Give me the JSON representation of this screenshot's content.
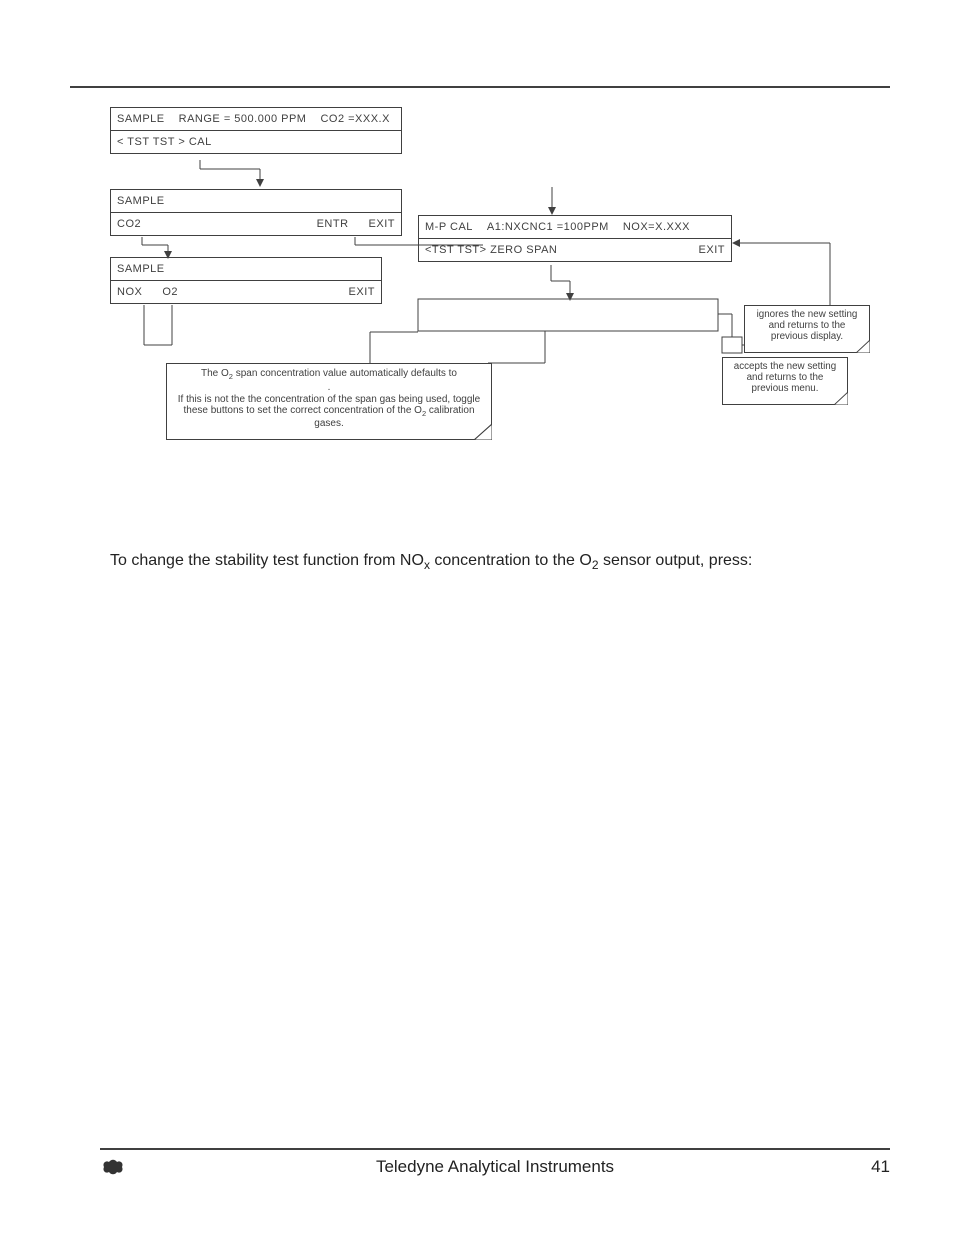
{
  "panel1": {
    "sample": "SAMPLE",
    "range": "RANGE = 500.000 PPM",
    "co2v": "CO2 =XXX.X",
    "row2": "< TST  TST >     CAL"
  },
  "panel2": {
    "sample": "SAMPLE",
    "co2": "CO2",
    "entr": "ENTR",
    "exit": "EXIT"
  },
  "panel3": {
    "sample": "SAMPLE",
    "nox": "NOX",
    "o2": "O2",
    "exit": "EXIT"
  },
  "panel4": {
    "mpcal": "M-P CAL",
    "a1": "A1:NXCNC1  =100PPM",
    "nox": "NOX=X.XXX",
    "row2a": "<TST  TST>  ZERO  SPAN",
    "exit": "EXIT"
  },
  "note_big_line1a": "The O",
  "note_big_line1b": " span concentration value automatically defaults to",
  "note_big_dot": ".",
  "note_big_line2": "If this is not the the concentration of the span gas being used, toggle these buttons to set the correct concentration of the O",
  "note_big_line2b": " calibration gases.",
  "note_ignores": "ignores the new setting and returns to the previous display.",
  "note_accepts": "accepts the new setting and returns to the previous menu.",
  "body_a": "To change the stability test function from NO",
  "body_b": " concentration to the O",
  "body_c": " sensor output, press:",
  "sub_x": "x",
  "sub_2": "2",
  "footer_company": "Teledyne Analytical Instruments",
  "footer_page": "41"
}
